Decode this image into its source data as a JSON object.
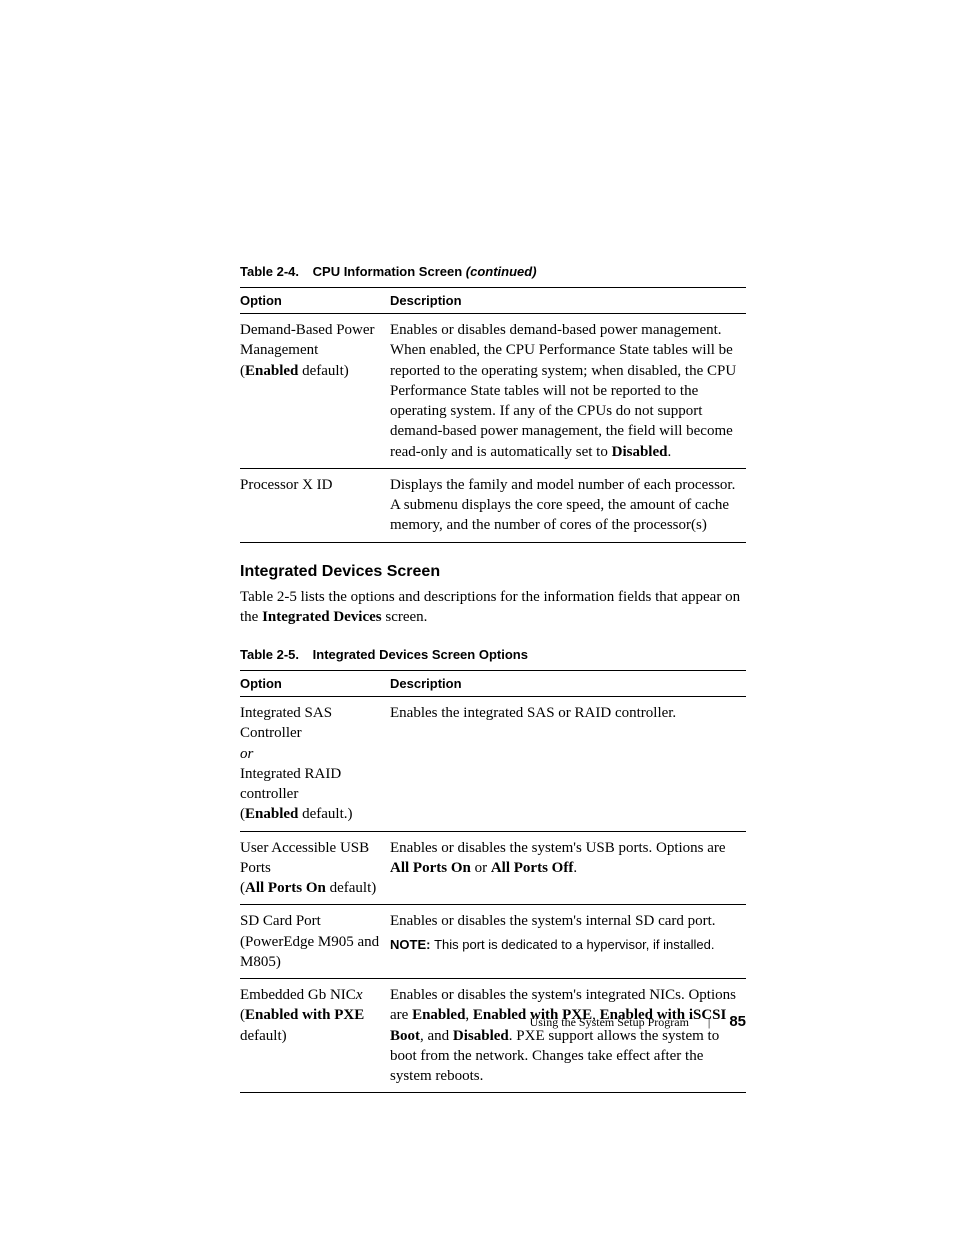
{
  "table1": {
    "caption_num": "Table 2-4.",
    "caption_title": "CPU Information Screen ",
    "caption_suffix": "(continued)",
    "head_option": "Option",
    "head_desc": "Description",
    "rows": [
      {
        "opt_l1": "Demand-Based Power Management",
        "opt_paren_open": "(",
        "opt_bold": "Enabled",
        "opt_after": " default)",
        "desc_pre": "Enables or disables demand-based power management. When enabled, the CPU Performance State tables will be reported to the operating system; when disabled, the CPU Performance State tables will not be reported to the operating system. If any of the CPUs do not support demand-based power management, the field will become read-only and is automatically set to ",
        "desc_bold1": "Disabled",
        "desc_post": "."
      },
      {
        "opt_l1": "Processor X ID",
        "desc_pre": "Displays the family and model number of each processor. A submenu displays the core speed, the amount of cache memory, and the number of cores of the processor(s)"
      }
    ]
  },
  "section": {
    "heading": "Integrated Devices Screen",
    "para_pre": "Table 2-5 lists the options and descriptions for the information fields that appear on the ",
    "para_bold": "Integrated Devices",
    "para_post": " screen."
  },
  "table2": {
    "caption_num": "Table 2-5.",
    "caption_title": "Integrated Devices Screen Options",
    "head_option": "Option",
    "head_desc": "Description",
    "rows": [
      {
        "opt_line1": "Integrated SAS Controller",
        "opt_or": "or",
        "opt_line2": "Integrated RAID controller",
        "opt_paren_open": "(",
        "opt_bold": "Enabled",
        "opt_after": " default.)",
        "desc_pre": "Enables the integrated SAS or RAID controller."
      },
      {
        "opt_line1": "User Accessible USB Ports",
        "opt_paren_open": "(",
        "opt_bold": "All Ports On",
        "opt_after": " default)",
        "desc_pre": "Enables or disables the system's USB ports. Options are ",
        "desc_b1": "All Ports On",
        "desc_mid1": " or ",
        "desc_b2": "All Ports Off",
        "desc_post": "."
      },
      {
        "opt_line1": "SD Card Port",
        "opt_line2": "(PowerEdge M905 and M805)",
        "desc_pre": "Enables or disables the system's internal SD card port.",
        "note_label": "NOTE: ",
        "note_text": "This port is dedicated to a hypervisor, if installed."
      },
      {
        "opt_line1_a": "Embedded Gb NIC",
        "opt_line1_ital": "x",
        "opt_paren_open": "(",
        "opt_bold": "Enabled with PXE",
        "opt_after": " default)",
        "desc_pre": "Enables or disables the system's integrated NICs. Options are ",
        "desc_b1": "Enabled",
        "desc_mid1": ", ",
        "desc_b2": "Enabled with PXE",
        "desc_mid2": ", ",
        "desc_b3": "Enabled with iSCSI Boot",
        "desc_mid3": ", and ",
        "desc_b4": "Disabled",
        "desc_post": ". PXE support allows the system to boot from the network. Changes take effect after the system reboots."
      }
    ]
  },
  "footer": {
    "section": "Using the System Setup Program",
    "page": "85"
  }
}
